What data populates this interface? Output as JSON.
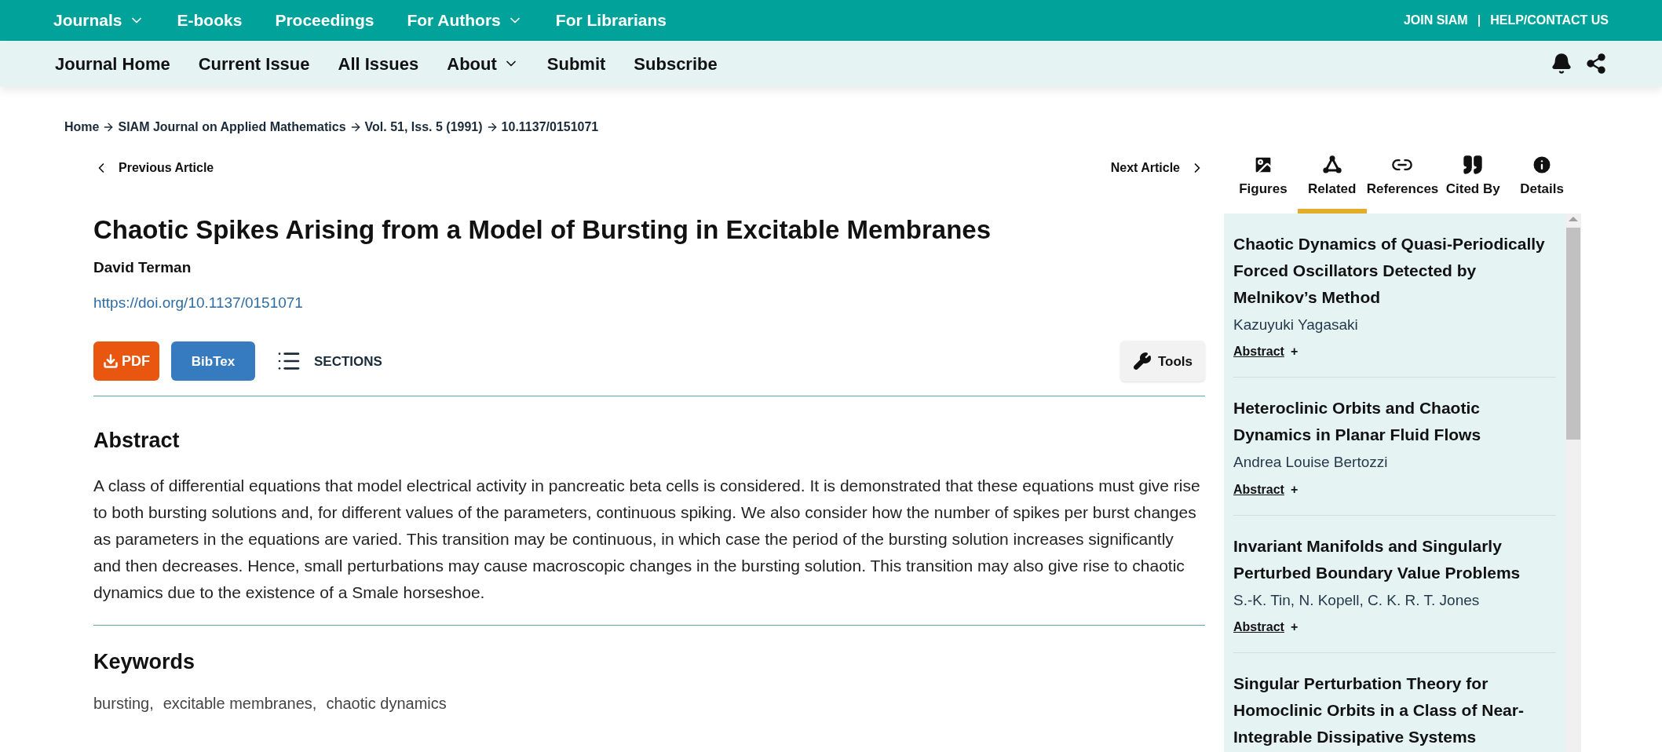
{
  "top_nav": {
    "items": [
      {
        "label": "Journals",
        "dropdown": true
      },
      {
        "label": "E-books",
        "dropdown": false
      },
      {
        "label": "Proceedings",
        "dropdown": false
      },
      {
        "label": "For Authors",
        "dropdown": true
      },
      {
        "label": "For Librarians",
        "dropdown": false
      }
    ],
    "links": [
      "JOIN SIAM",
      "|",
      "HELP/CONTACT US"
    ]
  },
  "journal_nav": {
    "items": [
      {
        "label": "Journal Home",
        "dropdown": false
      },
      {
        "label": "Current Issue",
        "dropdown": false
      },
      {
        "label": "All Issues",
        "dropdown": false
      },
      {
        "label": "About",
        "dropdown": true
      },
      {
        "label": "Submit",
        "dropdown": false
      },
      {
        "label": "Subscribe",
        "dropdown": false
      }
    ]
  },
  "breadcrumb": [
    "Home",
    "SIAM Journal on Applied Mathematics",
    "Vol. 51, Iss. 5 (1991)",
    "10.1137/0151071"
  ],
  "article_nav": {
    "previous": "Previous Article",
    "next": "Next Article"
  },
  "article": {
    "title": "Chaotic Spikes Arising from a Model of Bursting in Excitable Membranes",
    "author": "David Terman",
    "doi": "https://doi.org/10.1137/0151071",
    "actions": {
      "pdf": "PDF",
      "bibtex": "BibTex",
      "sections": "SECTIONS",
      "tools": "Tools"
    },
    "abstract_heading": "Abstract",
    "abstract": "A class of differential equations that model electrical activity in pancreatic beta cells is considered. It is demonstrated that these equations must give rise to both bursting solutions and, for different values of the parameters, continuous spiking. We also consider how the number of spikes per burst changes as parameters in the equations are varied. This transition may be continuous, in which case the period of the bursting solution increases significantly and then decreases. Hence, small perturbations may cause macroscopic changes in the bursting solution. This transition may also give rise to chaotic dynamics due to the existence of a Smale horseshoe.",
    "keywords_heading": "Keywords",
    "keywords": [
      "bursting,",
      "excitable membranes,",
      "chaotic dynamics"
    ]
  },
  "side_tabs": [
    {
      "label": "Figures",
      "kind": "image",
      "selected": false
    },
    {
      "label": "Related",
      "kind": "network",
      "selected": true
    },
    {
      "label": "References",
      "kind": "link",
      "selected": false
    },
    {
      "label": "Cited By",
      "kind": "quote",
      "selected": false
    },
    {
      "label": "Details",
      "kind": "info",
      "selected": false
    }
  ],
  "related": [
    {
      "title": "Chaotic Dynamics of Quasi-Periodically Forced Oscillators Detected by Melnikov’s Method",
      "authors": "Kazuyuki Yagasaki",
      "abstract": "Abstract",
      "toggle": "+"
    },
    {
      "title": "Heteroclinic Orbits and Chaotic Dynamics in Planar Fluid Flows",
      "authors": "Andrea Louise Bertozzi",
      "abstract": "Abstract",
      "toggle": "+"
    },
    {
      "title": "Invariant Manifolds and Singularly Perturbed Boundary Value Problems",
      "authors": "S.-K. Tin, N. Kopell, C. K. R. T. Jones",
      "abstract": "Abstract",
      "toggle": "+"
    },
    {
      "title": "Singular Perturbation Theory for Homoclinic Orbits in a Class of Near-Integrable Dissipative Systems"
    }
  ]
}
